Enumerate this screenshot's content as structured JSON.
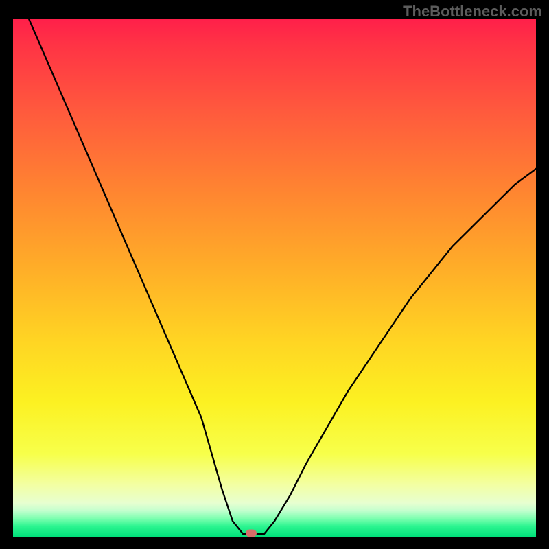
{
  "watermark": "TheBottleneck.com",
  "chart_data": {
    "type": "line",
    "title": "",
    "xlabel": "",
    "ylabel": "",
    "xlim": [
      0,
      100
    ],
    "ylim": [
      0,
      100
    ],
    "grid": false,
    "series": [
      {
        "name": "bottleneck-curve",
        "x": [
          3,
          6,
          9,
          12,
          15,
          18,
          21,
          24,
          27,
          30,
          33,
          36,
          38,
          40,
          42,
          44,
          48,
          50,
          53,
          56,
          60,
          64,
          68,
          72,
          76,
          80,
          84,
          88,
          92,
          96,
          100
        ],
        "y": [
          100,
          93,
          86,
          79,
          72,
          65,
          58,
          51,
          44,
          37,
          30,
          23,
          16,
          9,
          3,
          0.5,
          0.5,
          3,
          8,
          14,
          21,
          28,
          34,
          40,
          46,
          51,
          56,
          60,
          64,
          68,
          71
        ]
      }
    ],
    "annotations": [
      {
        "name": "optimal-marker",
        "x": 45.5,
        "y": 0.6
      }
    ],
    "background": "rainbow-vertical-gradient"
  }
}
